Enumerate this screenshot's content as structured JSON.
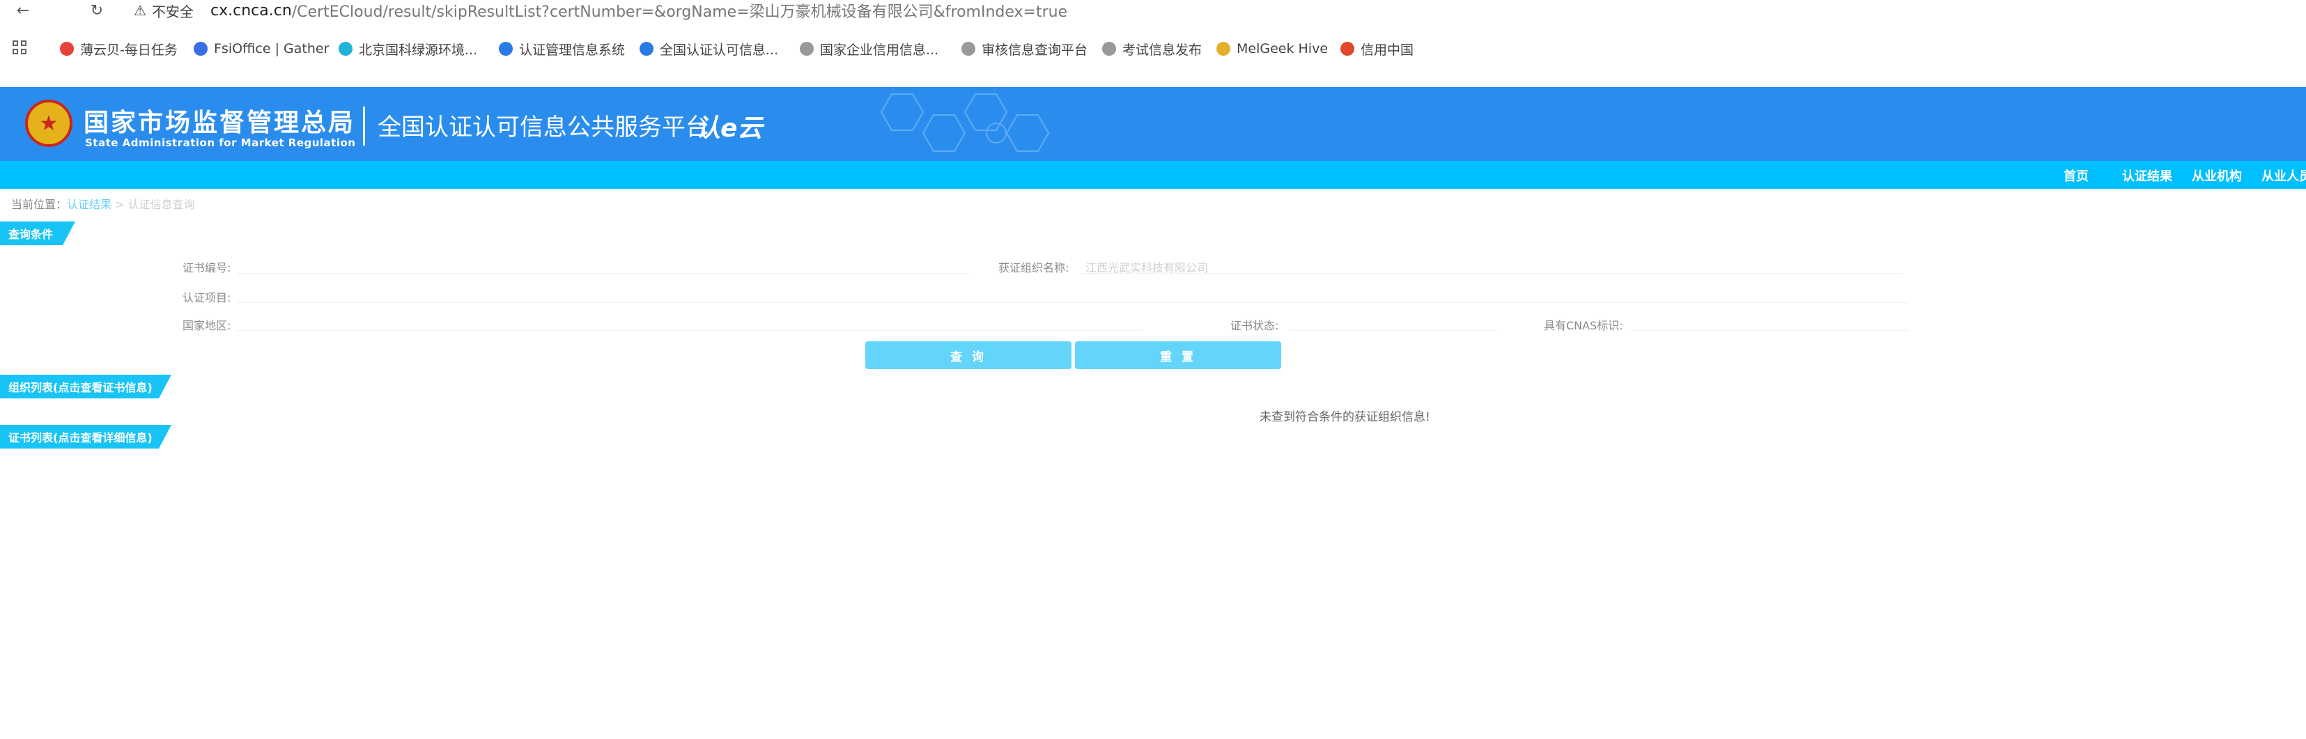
{
  "browser": {
    "back_icon": "arrow-left-icon",
    "reload_icon": "reload-icon",
    "insecure_label": "不安全",
    "url_host": "cx.cnca.cn",
    "url_path": "/CertECloud/result/skipResultList?certNumber=&orgName=梁山万豪机械设备有限公司&fromIndex=true"
  },
  "bookmarks": [
    {
      "label": "薄云贝-每日任务",
      "color": "#e8403a"
    },
    {
      "label": "FsiOffice | Gather",
      "color": "#3a6ee8"
    },
    {
      "label": "北京国科绿源环境...",
      "color": "#20b3d8"
    },
    {
      "label": "认证管理信息系统",
      "color": "#2a7be4"
    },
    {
      "label": "全国认证认可信息...",
      "color": "#2a7be4"
    },
    {
      "label": "国家企业信用信息...",
      "color": "#999999"
    },
    {
      "label": "审核信息查询平台",
      "color": "#999999"
    },
    {
      "label": "考试信息发布",
      "color": "#999999"
    },
    {
      "label": "MelGeek Hive",
      "color": "#e3b02a"
    },
    {
      "label": "信用中国",
      "color": "#e04a2a"
    }
  ],
  "header": {
    "agency_cn": "国家市场监督管理总局",
    "agency_en": "State Administration  for  Market Regulation",
    "platform_title": "全国认证认可信息公共服务平台",
    "brand_mark": "认e云",
    "bg_color": "#2a8dee"
  },
  "nav": {
    "items": [
      "首页",
      "认证结果",
      "从业机构",
      "从业人员"
    ],
    "bg_color": "#00bfff"
  },
  "breadcrumb": {
    "prefix": "当前位置：",
    "link": "认证结果",
    "separator": " > ",
    "current": "认证信息查询"
  },
  "search": {
    "section_title": "查询条件",
    "cert_no_label": "证书编号:",
    "org_name_label": "获证组织名称:",
    "org_name_value": "江西光武实科技有限公司",
    "project_label": "认证项目:",
    "region_label": "国家地区:",
    "status_label": "证书状态:",
    "cnas_label": "具有CNAS标识:",
    "query_button": "查 询",
    "reset_button": "重 置"
  },
  "org_list": {
    "section_title": "组织列表(点击查看证书信息)",
    "empty_message": "未查到符合条件的获证组织信息!"
  },
  "cert_list": {
    "section_title": "证书列表(点击查看详细信息)"
  },
  "colors": {
    "section_tab": "#17c4f5",
    "button": "#63d4fa"
  }
}
